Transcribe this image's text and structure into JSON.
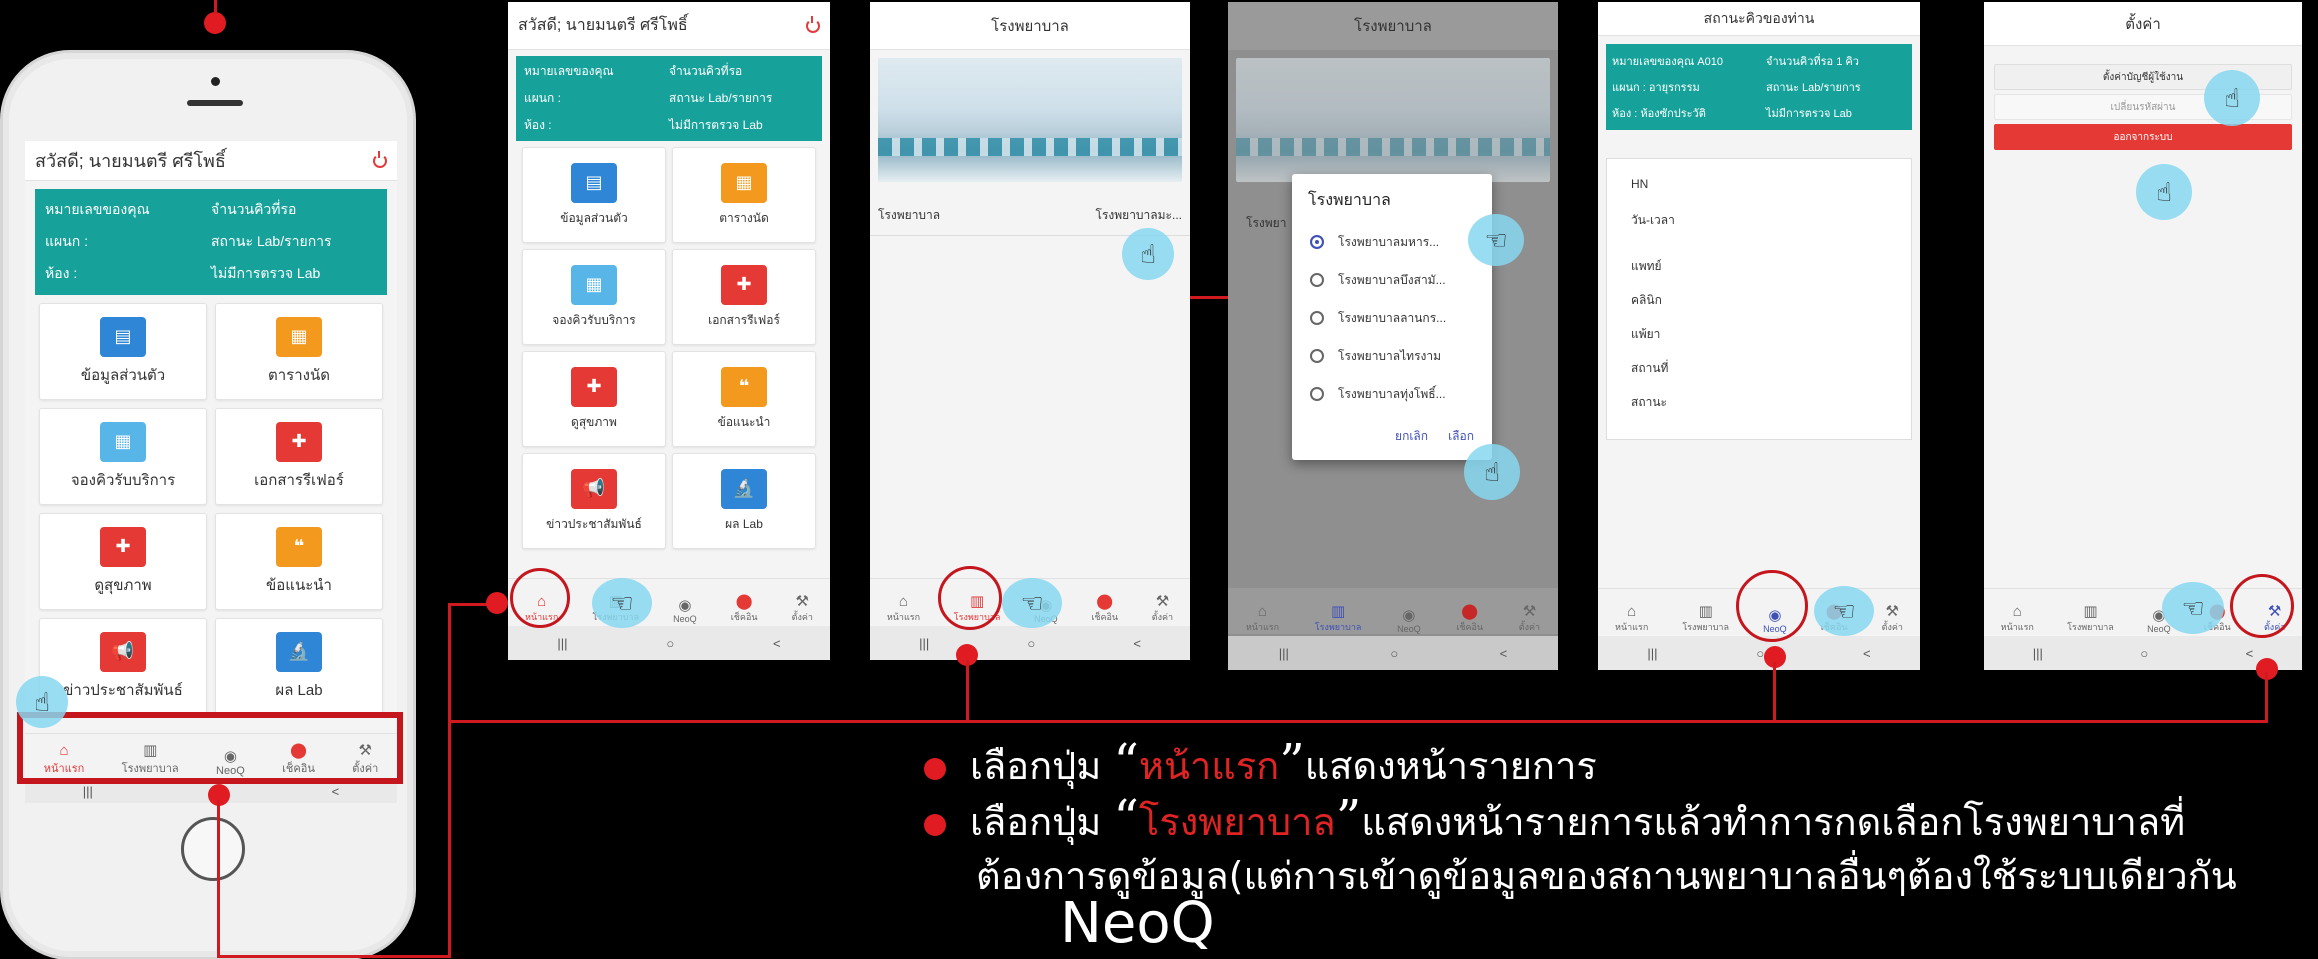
{
  "home": {
    "greeting": "สวัสดี; นายมนตรี ศรีโพธิ์",
    "info_rows": [
      {
        "label": "หมายเลขของคุณ",
        "value": "จำนวนคิวที่รอ"
      },
      {
        "label": "แผนก :",
        "value": "สถานะ Lab/รายการ"
      },
      {
        "label": "ห้อง :",
        "value": "ไม่มีการตรวจ Lab"
      }
    ],
    "tiles": [
      "ข้อมูลส่วนตัว",
      "ตารางนัด",
      "จองคิวรับบริการ",
      "เอกสารรีเฟอร์",
      "ดูสุขภาพ",
      "ข้อแนะนำ",
      "ข่าวประชาสัมพันธ์",
      "ผล Lab"
    ]
  },
  "nav": [
    "หน้าแรก",
    "โรงพยาบาล",
    "NeoQ",
    "เช็คอิน",
    "ตั้งค่า"
  ],
  "sys": [
    "|||",
    "○",
    "<"
  ],
  "hospital": {
    "title": "โรงพยาบาล",
    "field_label": "โรงพยาบาล",
    "field_value": "โรงพยาบาลมะ..."
  },
  "dialog": {
    "screen_title": "โรงพยาบาล",
    "title": "โรงพยาบาล",
    "partial_label": "โรงพยา",
    "options": [
      "โรงพยาบาลมหาร...",
      "โรงพยาบาลบึงสามั...",
      "โรงพยาบาลลานกร...",
      "โรงพยาบาลไทรงาม",
      "โรงพยาบาลทุ่งโพธิ์..."
    ],
    "cancel": "ยกเลิก",
    "select": "เลือก"
  },
  "queue": {
    "title": "สถานะคิวของท่าน",
    "info_rows": [
      {
        "label": "หมายเลขของคุณ A010",
        "value": "จำนวนคิวที่รอ 1 คิว"
      },
      {
        "label": "แผนก : อายุรกรรม",
        "value": "สถานะ Lab/รายการ"
      },
      {
        "label": "ห้อง : ห้องซักประวัติ",
        "value": "ไม่มีการตรวจ Lab"
      }
    ],
    "fields": [
      "HN",
      "วัน-เวลา",
      "แพทย์",
      "คลินิก",
      "แพ้ยา",
      "สถานที่",
      "สถานะ"
    ]
  },
  "settings": {
    "title": "ตั้งค่า",
    "account_button": "ตั้งค่าบัญชีผู้ใช้งาน",
    "password_button": "เปลี่ยนรหัสผ่าน",
    "logout_button": "ออกจากระบบ"
  },
  "captions": {
    "line1_prefix": "เลือกปุ่ม ",
    "line1_highlight": "หน้าแรก",
    "line1_suffix": "แสดงหน้ารายการ",
    "line2_prefix": "เลือกปุ่ม ",
    "line2_highlight": "โรงพยาบาล",
    "line2_suffix": "แสดงหน้ารายการแล้วทำการกดเลือกโรงพยาบาลที่",
    "line3": "ต้องการดูข้อมูล(แต่การเข้าดูข้อมูลของสถานพยาบาลอื่นๆต้องใช้ระบบเดียวกัน",
    "line4": "NeoQ",
    "open_quote": "“",
    "close_quote": "”"
  },
  "colors": {
    "teal": "#16a29a",
    "red": "#e01b22",
    "logout": "#e53935"
  }
}
